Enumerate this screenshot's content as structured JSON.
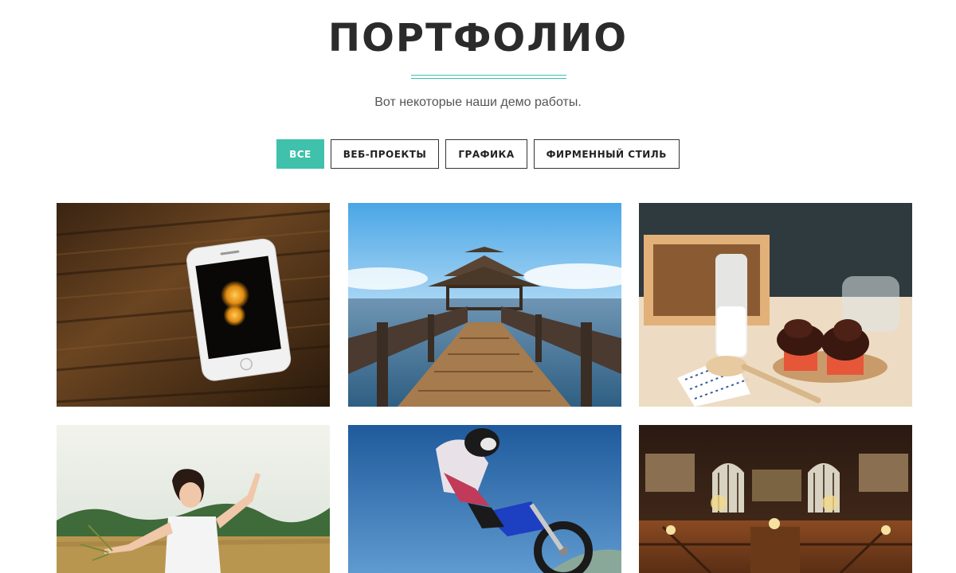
{
  "section": {
    "title": "ПОРТФОЛИО",
    "subtitle": "Вот некоторые наши демо работы."
  },
  "filters": [
    {
      "label": "ВСЕ",
      "active": true
    },
    {
      "label": "ВЕБ-ПРОЕКТЫ",
      "active": false
    },
    {
      "label": "ГРАФИКА",
      "active": false
    },
    {
      "label": "ФИРМЕННЫЙ СТИЛЬ",
      "active": false
    }
  ],
  "portfolio_items": [
    {
      "image": "smartphone-on-wooden-table"
    },
    {
      "image": "wooden-pier-with-gazebo"
    },
    {
      "image": "milk-bottle-and-cupcakes"
    },
    {
      "image": "woman-in-summer-field"
    },
    {
      "image": "motocross-jump"
    },
    {
      "image": "library-reading-room"
    }
  ],
  "colors": {
    "accent": "#3fc1ab",
    "title": "#2b2b2b"
  }
}
